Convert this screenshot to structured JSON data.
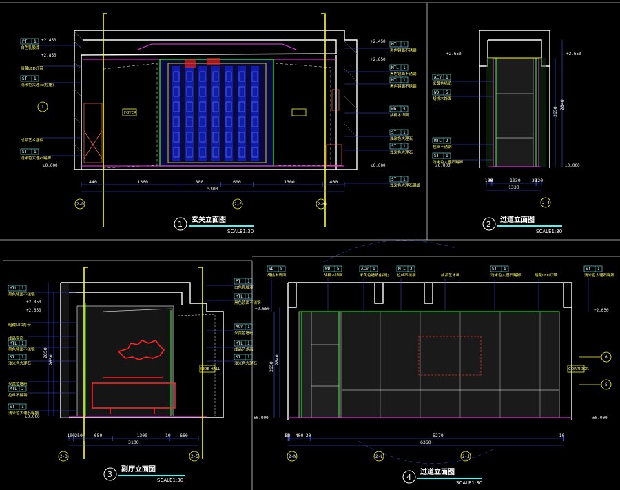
{
  "colors": {
    "background": "#000000",
    "wall": "#ffffff",
    "dimension": "#3f5bff",
    "leader": "#4a4aff",
    "accent_yellow": "#ffff00",
    "accent_magenta": "#ff33ff",
    "accent_green": "#33ff33",
    "accent_red": "#ff2222",
    "accent_cyan": "#33ffff",
    "tag": "#66ffff"
  },
  "views": [
    {
      "id": "v1",
      "number": "1",
      "title": "玄关立面图",
      "scale": "SCALE1:30",
      "levels": [
        "+2.450",
        "+2.850",
        "±0.000"
      ],
      "dims_bottom": [
        "440",
        "1360",
        "800",
        "600",
        "1300",
        "400"
      ],
      "dims_total": "5300",
      "axes": [
        "2-D",
        "2-F",
        "2-H"
      ],
      "left_tags": [
        {
          "code": "PT",
          "num": "1",
          "note": "白色乳胶漆"
        },
        {
          "code": "",
          "num": "",
          "note": "暗藏LED灯带"
        },
        {
          "code": "ST",
          "num": "1",
          "note": "浅米色大理石(拉槽)"
        },
        {
          "code": "",
          "num": "",
          "note": "成品艺术摆件"
        },
        {
          "code": "ST",
          "num": "1",
          "note": "浅米色大理石踢脚"
        }
      ],
      "right_tags": [
        {
          "code": "MTL",
          "num": "1",
          "note": "黑色镜面不锈钢"
        },
        {
          "code": "MTL",
          "num": "1",
          "note": "黑色镜面不锈钢"
        },
        {
          "code": "MTL",
          "num": "1",
          "note": "黑色镜面不锈钢"
        },
        {
          "code": "WD",
          "num": "5",
          "note": "胡桃木饰面"
        },
        {
          "code": "ST",
          "num": "1",
          "note": "浅米色大理石"
        },
        {
          "code": "ST",
          "num": "1",
          "note": "浅米色大理石"
        },
        {
          "code": "ST",
          "num": "1",
          "note": "浅米色大理石踢脚"
        }
      ],
      "callout": "FOYER",
      "section_mark": "1"
    },
    {
      "id": "v2",
      "number": "2",
      "title": "过道立面图",
      "scale": "SCALE1:30",
      "levels": [
        "+2.650",
        "+2.650",
        "±0.000",
        "±0.000"
      ],
      "dims_bottom": [
        "120",
        "30",
        "1030",
        "30",
        "120"
      ],
      "dims_total": "1330",
      "axes": [
        "2-4"
      ],
      "left_tags": [
        {
          "code": "ACV",
          "num": "1",
          "note": "米黄色墙纸"
        },
        {
          "code": "WD",
          "num": "5",
          "note": "胡桃木饰面"
        },
        {
          "code": "MTL",
          "num": "2",
          "note": "拉丝不锈钢"
        },
        {
          "code": "ST",
          "num": "1",
          "note": "浅米色大理石踢脚"
        }
      ],
      "vertical_dims": [
        "2840",
        "2650"
      ]
    },
    {
      "id": "v3",
      "number": "3",
      "title": "副厅立面图",
      "scale": "SCALE1:30",
      "levels": [
        "+2.850",
        "+2.650",
        "±0.000"
      ],
      "dims_bottom": [
        "100",
        "250",
        "650",
        "1300",
        "10",
        "660"
      ],
      "dims_total": "3100",
      "axes": [
        "2-3",
        "2-5"
      ],
      "left_tags": [
        {
          "code": "MTL",
          "num": "1",
          "note": "黑色镜面不锈钢"
        },
        {
          "code": "",
          "num": "",
          "note": "暗藏LED灯带"
        },
        {
          "code": "",
          "num": "",
          "note": "成品窗帘"
        },
        {
          "code": "MTL",
          "num": "1",
          "note": "黑色镜面不锈钢"
        },
        {
          "code": "ST",
          "num": "1",
          "note": "浅米色大理石"
        },
        {
          "code": "",
          "num": "",
          "note": "米黄色墙纸"
        },
        {
          "code": "MTL",
          "num": "2",
          "note": "拉丝不锈钢"
        },
        {
          "code": "ST",
          "num": "1",
          "note": "浅米色大理石踢脚"
        }
      ],
      "right_tags": [
        {
          "code": "PT",
          "num": "1",
          "note": "白色乳胶漆"
        },
        {
          "code": "MTL",
          "num": "1",
          "note": "黑色镜面不锈钢"
        },
        {
          "code": "ACV",
          "num": "1",
          "note": "米黄色墙纸"
        },
        {
          "code": "MTL",
          "num": "1",
          "note": "成品艺术画"
        },
        {
          "code": "ST",
          "num": "1",
          "note": "浅米色大理石"
        }
      ],
      "vertical_dims": [
        "2850",
        "2650"
      ],
      "callout": "SIDE HALL"
    },
    {
      "id": "v4",
      "number": "4",
      "title": "过道立面图",
      "scale": "SCALE1:30",
      "levels": [
        "+2.650",
        "+2.650",
        "±0.000",
        "±0.000"
      ],
      "dims_bottom": [
        "10",
        "30",
        "400",
        "30",
        "5270",
        "10"
      ],
      "dims_total": "6360",
      "axes": [
        "2-N",
        "2-L",
        "2-J"
      ],
      "top_tags": [
        {
          "code": "WD",
          "num": "5",
          "note": "胡桃木饰面"
        },
        {
          "code": "WD",
          "num": "5",
          "note": "胡桃木饰面"
        },
        {
          "code": "ACV",
          "num": "1",
          "note": "米黄色墙纸(拼缝)"
        },
        {
          "code": "MTL",
          "num": "2",
          "note": "拉丝不锈钢"
        },
        {
          "code": "",
          "num": "",
          "note": "成品艺术画"
        },
        {
          "code": "ST",
          "num": "1",
          "note": "浅米色大理石踢脚"
        },
        {
          "code": "",
          "num": "",
          "note": "暗藏LED灯带"
        },
        {
          "code": "ST",
          "num": "1",
          "note": "浅米色大理石踢脚"
        }
      ],
      "vertical_dims": [
        "2840",
        "2650"
      ],
      "section_marks": [
        "6",
        "5"
      ],
      "callout": "CORRIDOR"
    }
  ]
}
